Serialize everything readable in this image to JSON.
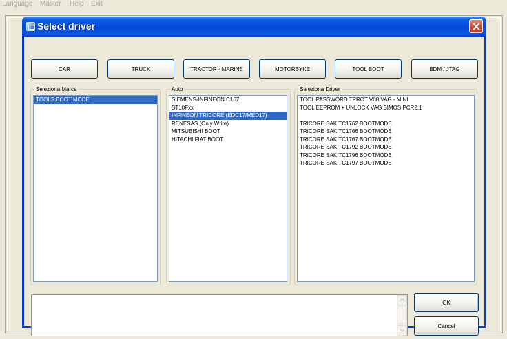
{
  "menubar": {
    "items": [
      "Language",
      "Master",
      "Help",
      "Exit"
    ]
  },
  "dialog": {
    "title": "Select driver",
    "categories": [
      "CAR",
      "TRUCK",
      "TRACTOR - MARINE",
      "MOTORBYKE",
      "TOOL BOOT",
      "BDM / JTAG"
    ],
    "marca": {
      "label": "Seleziona Marca",
      "items": [
        "TOOLS BOOT MODE"
      ],
      "selected_index": 0
    },
    "auto": {
      "label": "Auto",
      "items": [
        "SIEMENS-INFINEON C167",
        "ST10Fxx",
        "INFINEON TRICORE (EDC17/MED17)",
        "RENESAS (Only Write)",
        "MITSUBISHI BOOT",
        "HITACHI FIAT BOOT"
      ],
      "selected_index": 2
    },
    "driver": {
      "label": "Seleziona Driver",
      "items": [
        "TOOL PASSWORD TPROT V08 VAG - MINI",
        "TOOL EEPROM + UNLOCK VAG SIMOS PCR2.1",
        "",
        "TRICORE SAK TC1762  BOOTMODE",
        "TRICORE SAK TC1766  BOOTMODE",
        "TRICORE SAK TC1767  BOOTMODE",
        "TRICORE SAK TC1792  BOOTMODE",
        "TRICORE SAK TC1796  BOOTMODE",
        "TRICORE SAK TC1797  BOOTMODE"
      ]
    },
    "notes_text": "",
    "ok_label": "OK",
    "cancel_label": "Cancel"
  },
  "colors": {
    "title_blue": "#0249d8",
    "selection": "#316ac5",
    "face": "#ece9d8",
    "close_red": "#d4442a"
  },
  "icons": {
    "app": "window-app-icon",
    "close": "close-icon"
  }
}
